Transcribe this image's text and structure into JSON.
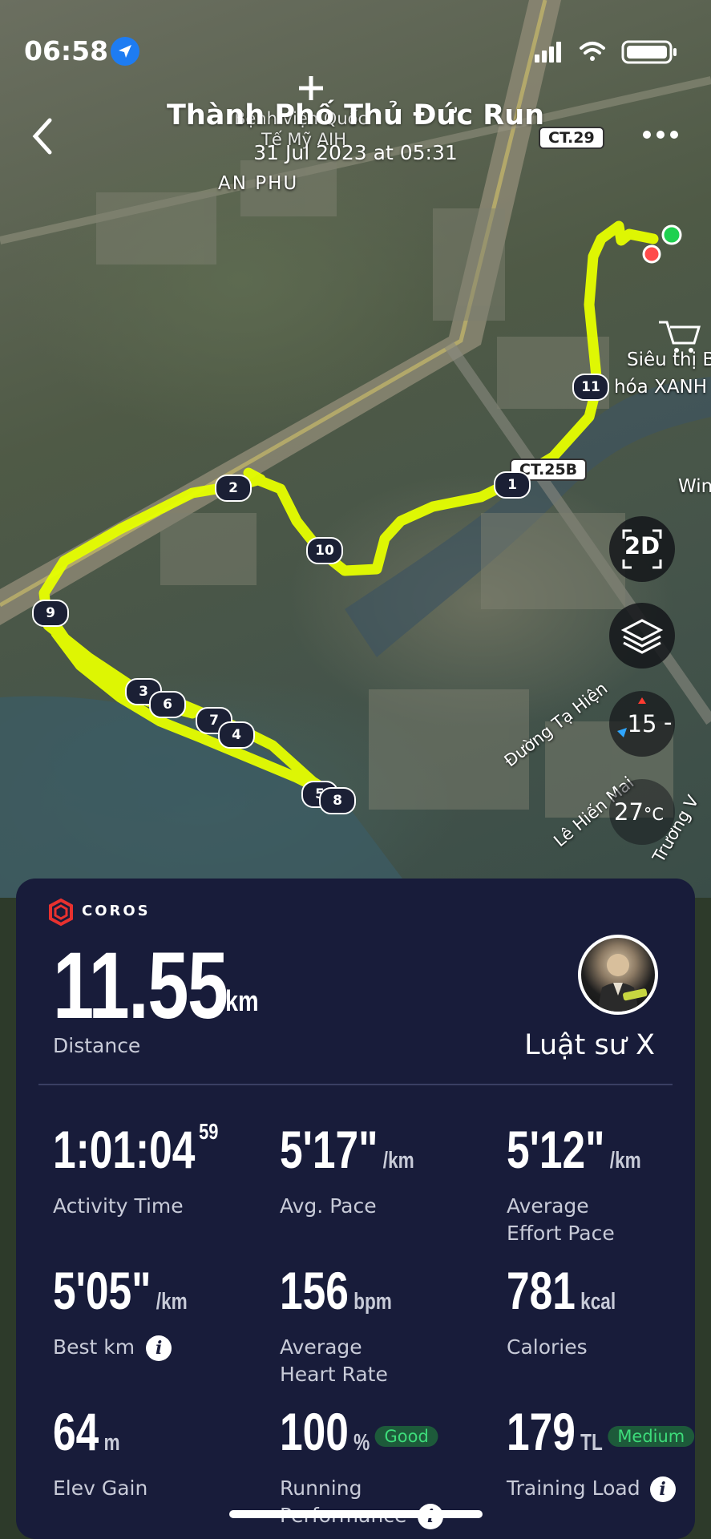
{
  "status_bar": {
    "time": "06:58"
  },
  "header": {
    "title": "Thành Phố Thủ Đức Run",
    "subtitle": "31 Jul 2023 at 05:31"
  },
  "map": {
    "road_badges": [
      "CT.29",
      "CT.25B"
    ],
    "place_labels": [
      "AN PHU",
      "Siêu thị Bác",
      "hóa XANH",
      "Win",
      "Đường Tạ Hiện",
      "Lê Hiến Mai",
      "Trương V",
      "Bệnh viện Quốc",
      "Tế Mỹ AIH"
    ],
    "lap_markers": [
      "1",
      "2",
      "3",
      "4",
      "5",
      "6",
      "7",
      "8",
      "9",
      "10",
      "11"
    ],
    "buttons": {
      "view_mode": "2D",
      "zoom": "15",
      "temperature": "27",
      "temperature_unit": "°C"
    }
  },
  "panel": {
    "brand": "COROS",
    "distance": {
      "value": "11.55",
      "unit": "km",
      "label": "Distance"
    },
    "username": "Luật sư X",
    "stats": [
      {
        "value": "1:01:04",
        "sup": "59",
        "unit": "",
        "label": "Activity Time"
      },
      {
        "value": "5'17\"",
        "unit": "/km",
        "label": "Avg. Pace"
      },
      {
        "value": "5'12\"",
        "unit": "/km",
        "label": "Average\nEffort Pace"
      },
      {
        "value": "5'05\"",
        "unit": "/km",
        "label": "Best km"
      },
      {
        "value": "156",
        "unit": "bpm",
        "label": "Average\nHeart Rate"
      },
      {
        "value": "781",
        "unit": "kcal",
        "label": "Calories"
      },
      {
        "value": "64",
        "unit": "m",
        "label": "Elev Gain"
      },
      {
        "value": "100",
        "unit": "%",
        "badge": "Good",
        "label": "Running\nPerformance"
      },
      {
        "value": "179",
        "unit": "TL",
        "badge": "Medium",
        "label": "Training Load"
      }
    ]
  },
  "colors": {
    "route": "#e6ff00",
    "panel_bg": "#181c3a",
    "badge_green": "#3ddc7a",
    "brand_red": "#e8312f"
  }
}
